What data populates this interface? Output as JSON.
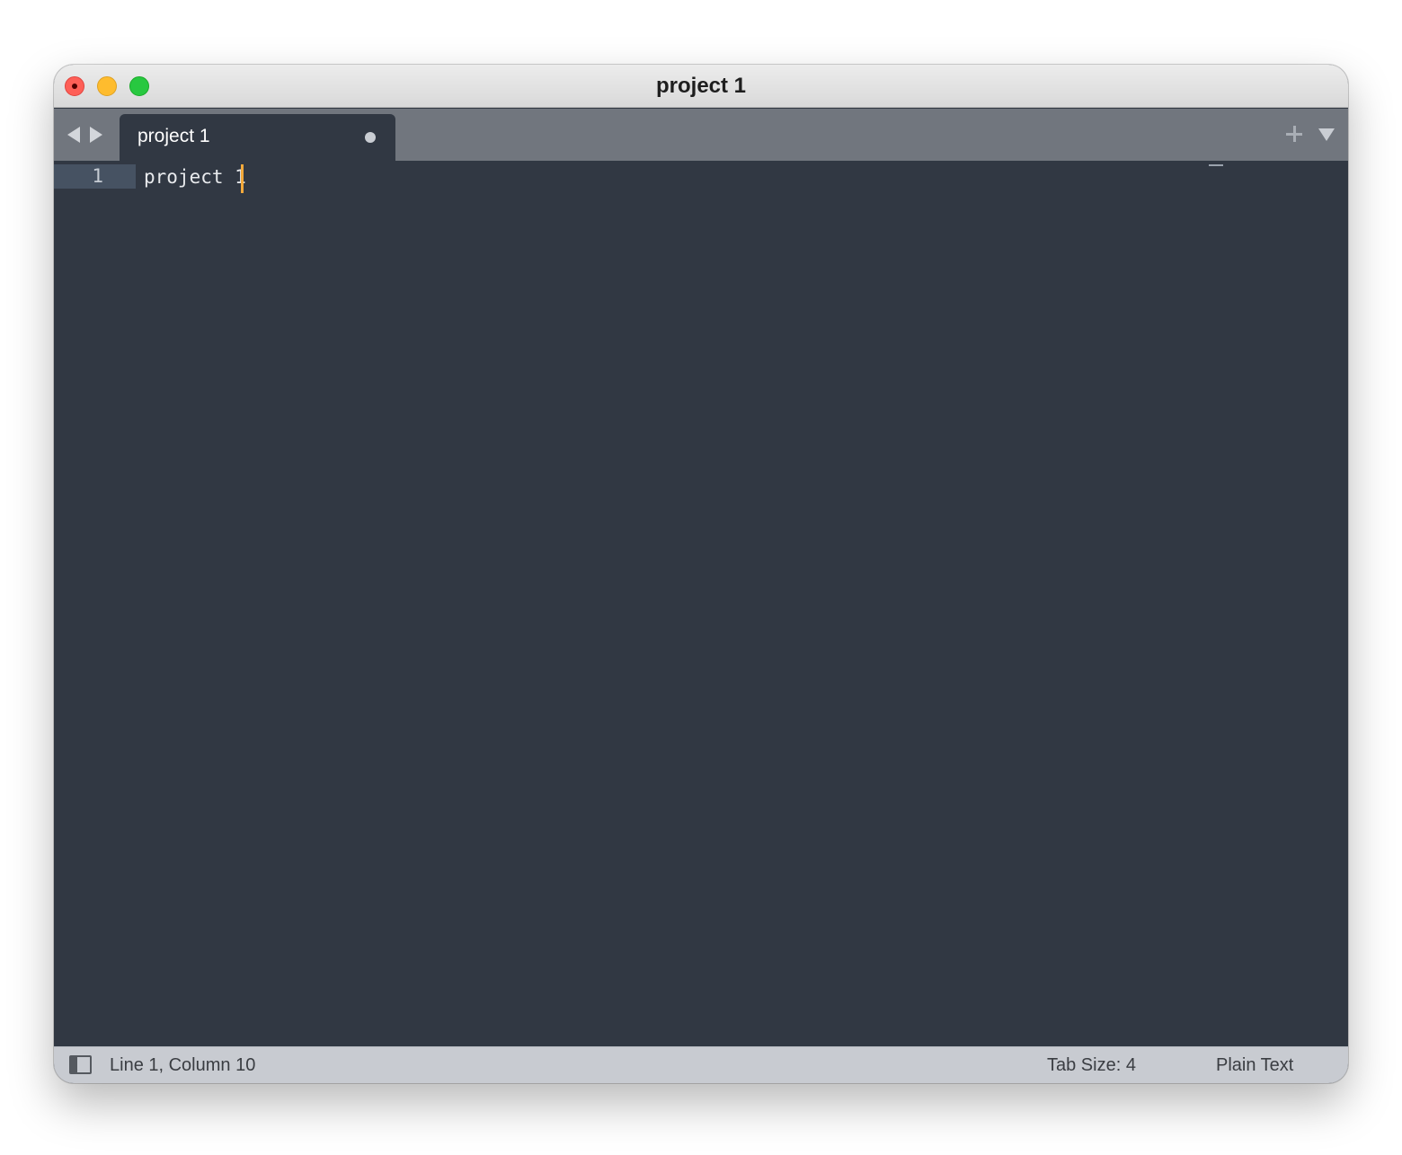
{
  "window": {
    "title": "project 1"
  },
  "tabs": [
    {
      "label": "project 1",
      "modified": true
    }
  ],
  "editor": {
    "lines": [
      {
        "number": "1",
        "text": "project 1"
      }
    ],
    "caret_color": "#f2a93b",
    "background": "#313843"
  },
  "status_bar": {
    "position": "Line 1, Column 10",
    "tab_size": "Tab Size: 4",
    "syntax": "Plain Text"
  },
  "icons": {
    "close": "close-icon",
    "minimize": "minimize-icon",
    "maximize": "maximize-icon",
    "back": "back-arrow-icon",
    "forward": "forward-arrow-icon",
    "new_tab": "plus-icon",
    "tab_menu": "triangle-down-icon",
    "sidebar": "sidebar-toggle-icon"
  }
}
